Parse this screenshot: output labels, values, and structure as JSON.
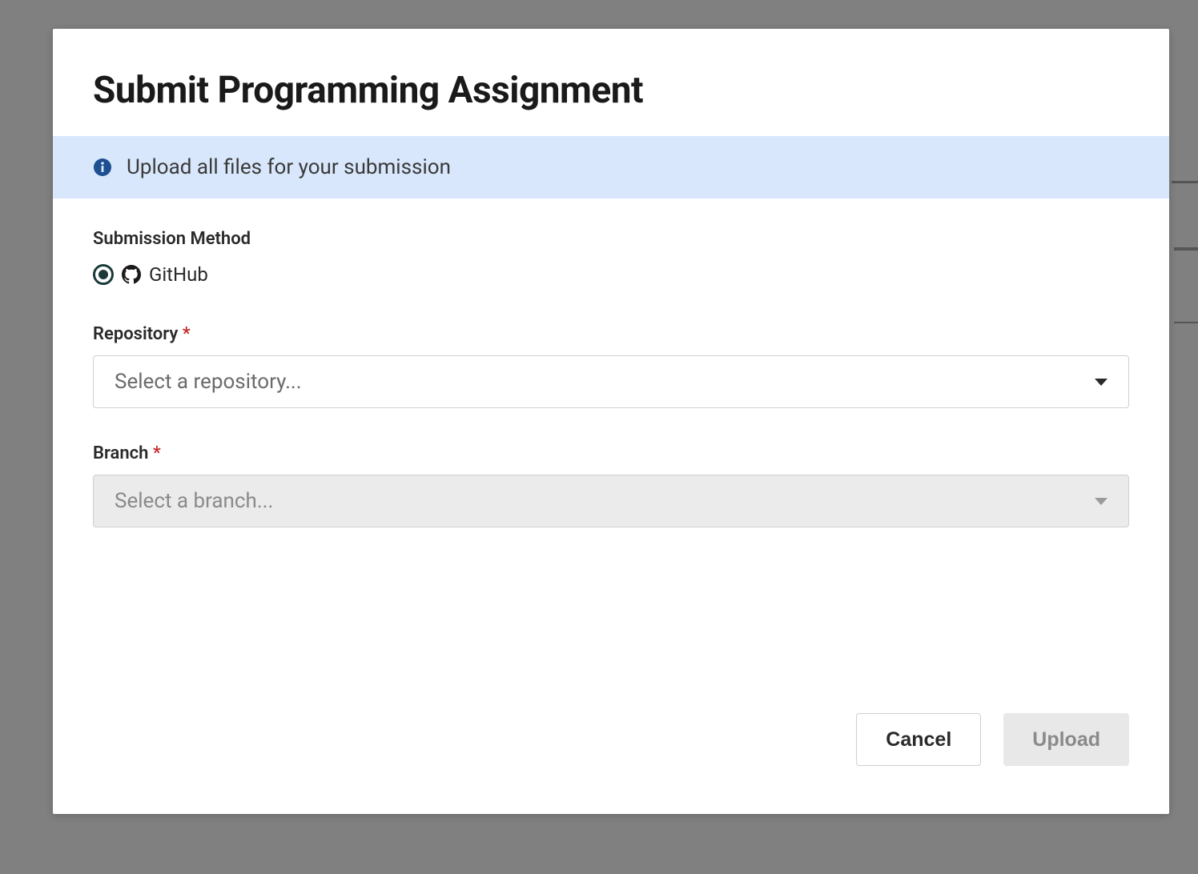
{
  "modal": {
    "title": "Submit Programming Assignment",
    "info_banner": "Upload all files for your submission",
    "submission_method": {
      "label": "Submission Method",
      "options": [
        {
          "label": "GitHub",
          "selected": true
        }
      ]
    },
    "fields": {
      "repository": {
        "label": "Repository",
        "required": true,
        "placeholder": "Select a repository...",
        "disabled": false
      },
      "branch": {
        "label": "Branch",
        "required": true,
        "placeholder": "Select a branch...",
        "disabled": true
      }
    },
    "footer": {
      "cancel_label": "Cancel",
      "upload_label": "Upload"
    }
  }
}
